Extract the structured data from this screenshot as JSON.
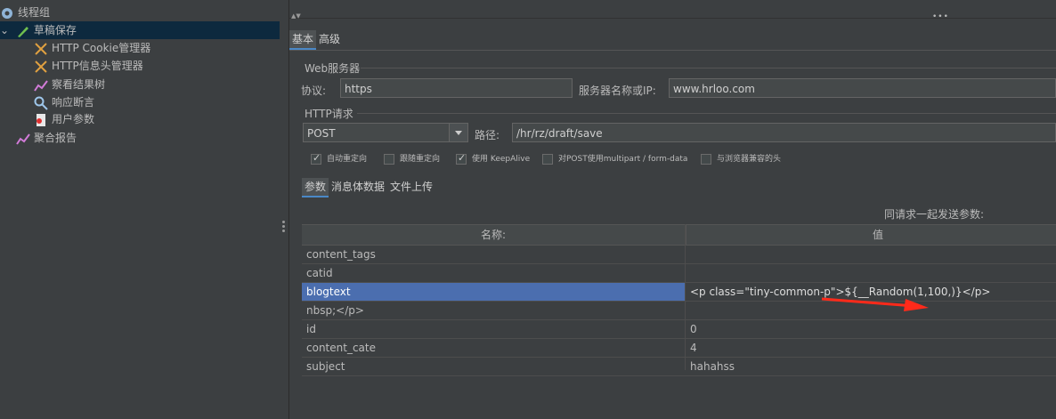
{
  "tree": {
    "items": [
      {
        "label": "线程组",
        "icon": "gear-icon"
      },
      {
        "label": "草稿保存",
        "icon": "pen-icon"
      },
      {
        "label": "HTTP Cookie管理器",
        "icon": "wrench-icon"
      },
      {
        "label": "HTTP信息头管理器",
        "icon": "wrench-icon"
      },
      {
        "label": "察看结果树",
        "icon": "chart-icon"
      },
      {
        "label": "响应断言",
        "icon": "magnifier-icon"
      },
      {
        "label": "用户参数",
        "icon": "doc-icon"
      },
      {
        "label": "聚合报告",
        "icon": "chart-icon"
      }
    ]
  },
  "tabs": {
    "basic": "基本",
    "advanced": "高级"
  },
  "web_server": {
    "group_label": "Web服务器",
    "protocol_label": "协议:",
    "protocol_value": "https",
    "server_label": "服务器名称或IP:",
    "server_value": "www.hrloo.com"
  },
  "http_request": {
    "group_label": "HTTP请求",
    "method_value": "POST",
    "path_label": "路径:",
    "path_value": "/hr/rz/draft/save"
  },
  "options": [
    {
      "label": "自动重定向",
      "checked": true
    },
    {
      "label": "跟随重定向",
      "checked": false
    },
    {
      "label": "使用 KeepAlive",
      "checked": true
    },
    {
      "label": "对POST使用multipart / form-data",
      "checked": false
    },
    {
      "label": "与浏览器兼容的头",
      "checked": false
    }
  ],
  "subtabs": {
    "params": "参数",
    "body": "消息体数据",
    "files": "文件上传"
  },
  "params_caption": "同请求一起发送参数:",
  "table": {
    "headers": {
      "name": "名称:",
      "value": "值"
    },
    "rows": [
      {
        "name": "content_tags",
        "value": ""
      },
      {
        "name": "catid",
        "value": ""
      },
      {
        "name": "blogtext",
        "value": "<p class=\"tiny-common-p\">${__Random(1,100,)}</p>"
      },
      {
        "name": "nbsp;</p>",
        "value": ""
      },
      {
        "name": "id",
        "value": "0"
      },
      {
        "name": "content_cate",
        "value": "4"
      },
      {
        "name": "subject",
        "value": "hahahss"
      }
    ]
  },
  "colors": {
    "accent_arrow": "#ff2a1a",
    "selection": "#4b6eaf"
  }
}
